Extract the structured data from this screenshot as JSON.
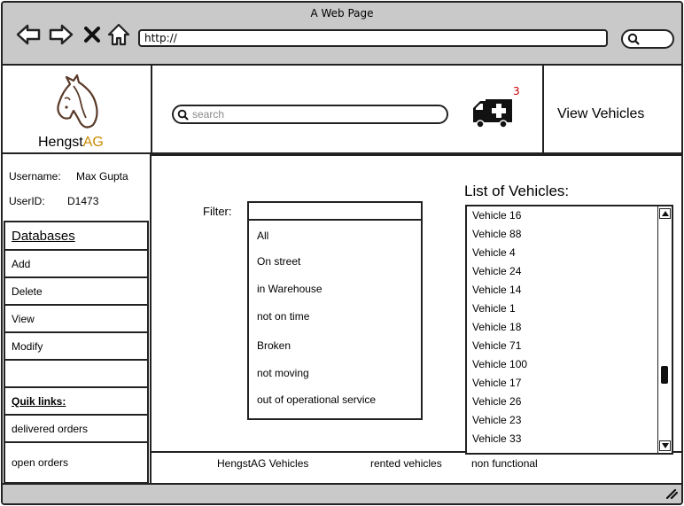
{
  "browser": {
    "title": "A Web Page",
    "url": "http://"
  },
  "header": {
    "logo_primary": "Hengst",
    "logo_accent": "AG",
    "search_placeholder": "search",
    "notification_count": "3",
    "view_vehicles_label": "View Vehicles"
  },
  "user": {
    "username_label": "Username:",
    "username_value": "Max Gupta",
    "userid_label": "UserID:",
    "userid_value": "D1473"
  },
  "sidebar": {
    "databases_heading": "Databases",
    "items": [
      "Add",
      "Delete",
      "View",
      "Modify"
    ],
    "quik_links_heading": "Quik links:",
    "links": [
      "delivered orders",
      "open orders"
    ]
  },
  "filter": {
    "label": "Filter:",
    "value": "",
    "options": [
      "All",
      "On street",
      "in Warehouse",
      "not on time",
      "Broken",
      "not moving",
      "out of operational service"
    ]
  },
  "vehicle_list": {
    "title": "List of Vehicles:",
    "items": [
      "Vehicle 16",
      "Vehicle 88",
      "Vehicle 4",
      "Vehicle 24",
      "Vehicle 14",
      "Vehicle 1",
      "Vehicle 18",
      "Vehicle 71",
      "Vehicle 100",
      "Vehicle 17",
      "Vehicle 26",
      "Vehicle 23",
      "Vehicle 33"
    ]
  },
  "footer": {
    "links": [
      "HengstAG Vehicles",
      "rented vehicles",
      "non functional"
    ]
  },
  "colors": {
    "chrome": "#c9c9c9",
    "logo_accent": "#c98a00",
    "badge": "#cc0000"
  }
}
